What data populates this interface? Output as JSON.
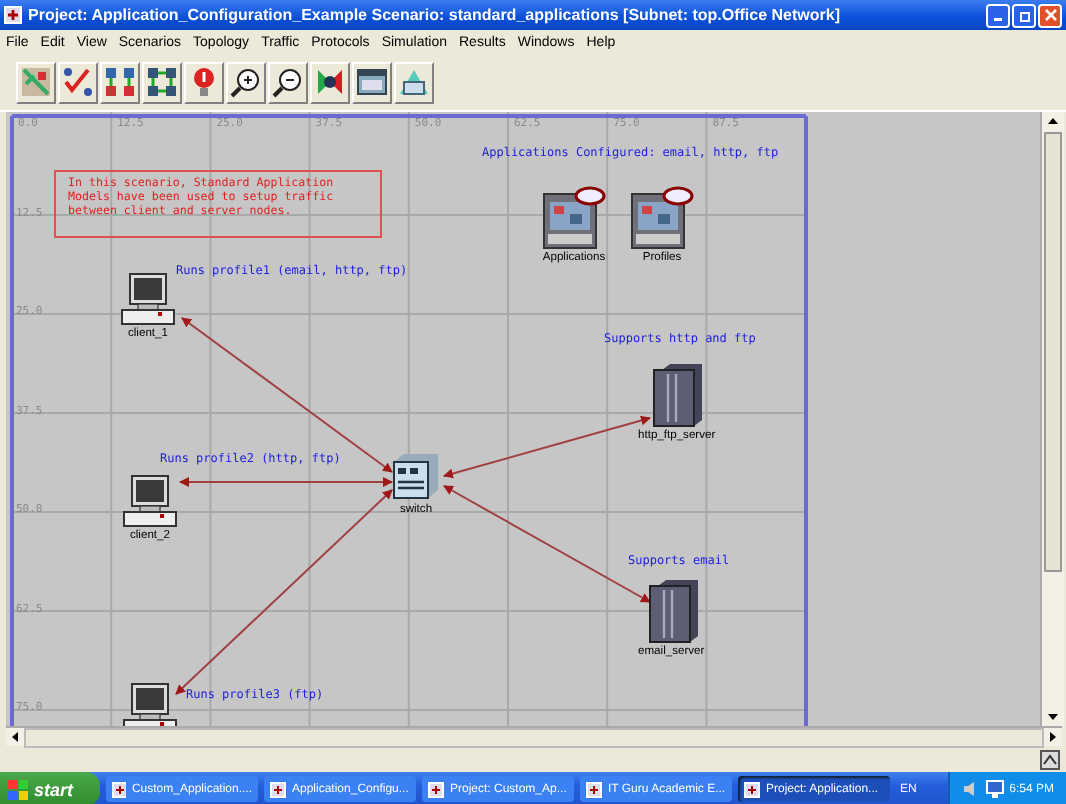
{
  "window": {
    "title": "Project: Application_Configuration_Example Scenario: standard_applications  [Subnet: top.Office Network]"
  },
  "menu": [
    "File",
    "Edit",
    "View",
    "Scenarios",
    "Topology",
    "Traffic",
    "Protocols",
    "Simulation",
    "Results",
    "Windows",
    "Help"
  ],
  "canvas": {
    "x_ticks": [
      "0.0",
      "12.5",
      "25.0",
      "37.5",
      "50.0",
      "62.5",
      "75.0",
      "87.5"
    ],
    "y_ticks": [
      "12.5",
      "25.0",
      "37.5",
      "50.0",
      "62.5",
      "75.0"
    ],
    "note": "In this scenario, Standard Application Models have been used to setup traffic between client and server nodes.",
    "annotations": [
      "Applications Configured: email, http, ftp",
      "Runs profile1 (email, http, ftp)",
      "Supports http and ftp",
      "Runs profile2 (http, ftp)",
      "Supports email",
      "Runs profile3 (ftp)"
    ],
    "nodes": [
      {
        "kind": "config",
        "label": "Applications"
      },
      {
        "kind": "config",
        "label": "Profiles"
      },
      {
        "kind": "client",
        "label": "client_1"
      },
      {
        "kind": "server",
        "label": "http_ftp_server"
      },
      {
        "kind": "client",
        "label": "client_2"
      },
      {
        "kind": "switch",
        "label": "switch"
      },
      {
        "kind": "server",
        "label": "email_server"
      },
      {
        "kind": "client"
      }
    ]
  },
  "taskbar": {
    "start": "start",
    "items": [
      {
        "label": "Custom_Application....",
        "selected": false
      },
      {
        "label": "Application_Configu...",
        "selected": false
      },
      {
        "label": "Project: Custom_Ap...",
        "selected": false
      },
      {
        "label": "IT Guru Academic E...",
        "selected": false
      },
      {
        "label": "Project: Application...",
        "selected": true
      }
    ],
    "language": "EN",
    "clock": "6:54 PM"
  }
}
